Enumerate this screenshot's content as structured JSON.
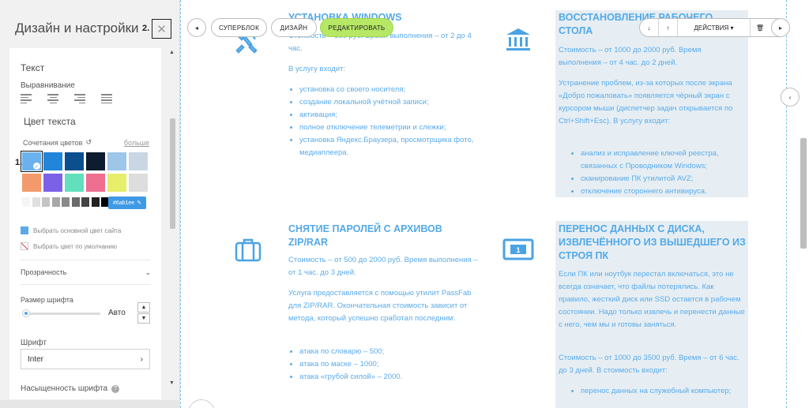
{
  "panel": {
    "title": "Дизайн и настройки",
    "close_symbol": "✕",
    "label_2": "2.",
    "label_1": "1.",
    "text_section": "Текст",
    "align_label": "Выравнивание",
    "text_color_label": "Цвет текста",
    "combos_label": "Сочетания цветов",
    "reset_symbol": "↺",
    "more_label": "больше",
    "hex_value": "#6ab1ee",
    "pencil_symbol": "✎",
    "site_color_label": "Выбрать основной цвет сайта",
    "default_color_label": "Выбрать цвет по умолчанию",
    "transparency_label": "Прозрачность",
    "chevron_down": "⌄",
    "font_size_label": "Размер шрифта",
    "font_size_value": "Авто",
    "font_size_level": 0,
    "step_up": "▲",
    "step_down": "▼",
    "font_label": "Шрифт",
    "font_value": "Inter",
    "font_chevron": "›",
    "weight_label": "Насыщенность шрифта",
    "help_symbol": "?",
    "scroll_up": "▲",
    "scroll_down": "▼",
    "swatches_row1": [
      "#6ab1ee",
      "#2185d9",
      "#0b4f8f",
      "#0d1c2f",
      "#9dc6e8",
      "#c9d7e4"
    ],
    "swatches_row2": [
      "#f29a6c",
      "#7b61e8",
      "#62e0bd",
      "#ee6f8f",
      "#e6ee6a",
      "#dddddd"
    ],
    "grays": [
      "#f5f5f5",
      "#e0e0e0",
      "#c4c4c4",
      "#a8a8a8",
      "#8a8a8a",
      "#6b6b6b",
      "#444444",
      "#222222",
      "#000000"
    ],
    "selected_swatch_index": 0
  },
  "toolbar": {
    "prev_symbol": "◂",
    "superblock_label": "СУПЕРБЛОК",
    "design_label": "ДИЗАЙН",
    "edit_label": "РЕДАКТИРОВАТЬ",
    "down_symbol": "↓",
    "up_symbol": "↑",
    "actions_label": "ДЕЙСТВИЯ ▾",
    "trash_symbol": "🗑",
    "next_symbol": "▸",
    "side_prev_symbol": "‹"
  },
  "cards": {
    "windows": {
      "title": "УСТАНОВКА WINDOWS",
      "price": "Стоимость – 500 руб. Время выполнения – от 2 до 4 час.",
      "intro": "В услугу входит:",
      "items": [
        "установка со своего носителя;",
        "создание локальной учётной записи;",
        "активация;",
        "полное отключение телеметрии и слежки;",
        "установка Яндекс.Браузера, просмотрщика фото, медиаплеера."
      ]
    },
    "restore": {
      "title": "ВОССТАНОВЛЕНИЕ РАБОЧЕГО СТОЛА",
      "price": "Стоимость – от 1000 до 2000 руб. Время выполнения – от 4 час. до 2 дней.",
      "desc": "Устранение проблем, из-за которых после экрана «Добро пожаловать» появляется чёрный экран с курсором мыши (диспетчер задач открывается по Ctrl+Shift+Esc). В услугу входит:",
      "items": [
        "анализ и исправление ключей реестра, связанных с Проводником Windows;",
        "сканирование ПК утилитой AVZ;",
        "отключение стороннего антивируса."
      ]
    },
    "passwords": {
      "title": "СНЯТИЕ ПАРОЛЕЙ С АРХИВОВ ZIP/RAR",
      "price": "Стоимость – от 500 до 2000 руб. Время выполнения – от 1 час. до 3 дней.",
      "desc": "Услуга предоставляется с помощью утилит PassFab для ZIP/RAR. Окончательная стоимость зависит от метода, который успешно сработал последним:",
      "items": [
        "атака по словарю – 500;",
        "атака по маске – 1000;",
        "атака «грубой силой» – 2000."
      ]
    },
    "transfer": {
      "title": "ПЕРЕНОС ДАННЫХ С ДИСКА, ИЗВЛЕЧЁННОГО ИЗ ВЫШЕДШЕГО ИЗ СТРОЯ ПК",
      "desc": "Если ПК или ноутбук перестал включаться, это не всегда означает, что файлы потерялись. Как правило, жесткий диск или SSD остается в рабочем состоянии. Надо только извлечь и перенести данные с него, чем мы и готовы заняться.",
      "price": "Стоимость – от 1000 до 3500 руб. Время – от 6 час. до 3 дней. В стоимость входит:",
      "items": [
        "перенос данных на служебный компьютер;"
      ]
    }
  },
  "icons": {
    "windows": "tools-icon",
    "restore": "bank-icon",
    "passwords": "briefcase-icon",
    "transfer": "banknote-icon"
  },
  "colors": {
    "accent": "#53a9e8",
    "edit_button": "#b6e765",
    "shade": "#e6eef3"
  }
}
